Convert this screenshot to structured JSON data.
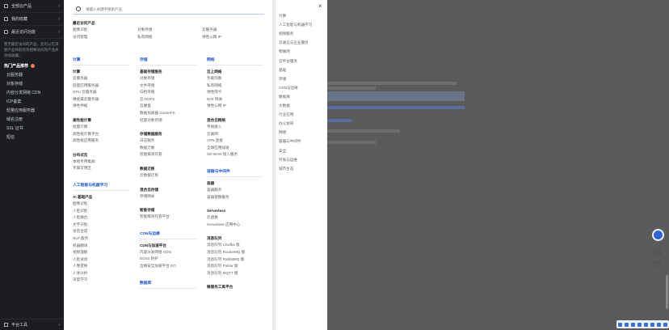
{
  "sidebar": {
    "top_rows": [
      {
        "label": "全部云产品"
      },
      {
        "label": "我的收藏"
      },
      {
        "label": "最近访问功能"
      }
    ],
    "desc": "暂无最近访问的产品。您可以在顶部产品导航找到想要访问的产品并添加收藏。",
    "hot_title": "热门产品推荐",
    "items": [
      "云服务器",
      "对象存储",
      "内容分发网络 CDN",
      "ICP备案",
      "轻量应用服务器",
      "域名注册",
      "SSL 证书",
      "短信"
    ],
    "bottom": "平台工具"
  },
  "search": {
    "placeholder": "请输入关键字搜索产品"
  },
  "columns": [
    {
      "blocks": [
        {
          "sub": "最近访问产品",
          "links": [
            "图像识别",
            "访问管理"
          ]
        }
      ]
    },
    {
      "blocks": [
        {
          "sub": "",
          "links": [
            "对象存储",
            "私有网络"
          ]
        }
      ]
    },
    {
      "blocks": [
        {
          "sub": "",
          "links": [
            "云服务器",
            "弹性公网 IP"
          ]
        }
      ]
    }
  ],
  "col1": {
    "sections": [
      {
        "cat": "计算",
        "blocks": [
          {
            "sub": "计算",
            "links": [
              "云服务器",
              "轻量应用服务器",
              "GPU 云服务器",
              "裸金属云服务器",
              "弹性伸缩"
            ]
          },
          {
            "sub": "高性能计算",
            "links": [
              "批量计算",
              "高性能计算平台",
              "高性能应用服务"
            ]
          },
          {
            "sub": "分布式云",
            "links": [
              "本地专用集群",
              "专属可用区"
            ]
          }
        ]
      },
      {
        "cat": "人工智能与机器学习",
        "blocks": [
          {
            "sub": "AI 基础产品",
            "links": [
              "图像识别",
              "人脸识别",
              "人脸融合",
              "文字识别",
              "语音合成",
              "NLP 服务",
              "机器翻译",
              "视频理解",
              "人脸试妆",
              "人像变换",
              "人体分析",
              "深度学习"
            ]
          }
        ]
      }
    ]
  },
  "col2": {
    "sections": [
      {
        "cat": "存储",
        "blocks": [
          {
            "sub": "基础存储服务",
            "links": [
              "对象存储",
              "文件存储",
              "归档存储",
              "云 HDFS",
              "云硬盘",
              "数据加速器 GooseFS",
              "轻量对象存储"
            ]
          },
          {
            "sub": "存储数据服务",
            "links": [
              "日志服务",
              "数据万象",
              "智能媒资托管"
            ]
          },
          {
            "sub": "数据迁移",
            "links": [
              "云数据迁移"
            ]
          },
          {
            "sub": "混合云存储",
            "links": [
              "存储网关"
            ]
          },
          {
            "sub": "智能存储",
            "links": [
              "智能媒资托管平台"
            ]
          }
        ]
      },
      {
        "cat": "CDN与边缘",
        "blocks": [
          {
            "sub": "CDN与加速平台",
            "links": [
              "内容分发网络 CDN",
              "DDoS 防护",
              "边缘安全加速平台 EO"
            ]
          }
        ]
      },
      {
        "cat": "数据库",
        "blocks": []
      }
    ]
  },
  "col3": {
    "sections": [
      {
        "cat": "网络",
        "blocks": [
          {
            "sub": "云上网络",
            "links": [
              "负载均衡",
              "私有网络",
              "弹性网卡",
              "NAT 网关",
              "弹性公网 IP"
            ]
          },
          {
            "sub": "混合云网络",
            "links": [
              "专线接入",
              "云联网",
              "VPN 连接",
              "全球应用加速",
              "SD-WAN 接入服务"
            ]
          }
        ]
      },
      {
        "cat": "容器与中间件",
        "blocks": [
          {
            "sub": "容器",
            "links": [
              "容器服务",
              "容器镜像服务"
            ]
          },
          {
            "sub": "Serverless",
            "links": [
              "云函数",
              "Serverless 应用中心"
            ]
          },
          {
            "sub": "消息队列",
            "links": [
              "消息队列 CKafka 版",
              "消息队列 RocketMQ 版",
              "消息队列 RabbitMQ 版",
              "消息队列 Pulsar 版",
              "消息队列 MQTT 版"
            ]
          },
          {
            "sub": "微服务工具平台",
            "links": []
          }
        ]
      }
    ]
  },
  "right_nav": [
    "计算",
    "人工智能与机器学习",
    "视频服务",
    "云通信与企业服务",
    "物联网",
    "云平台服务",
    "基础",
    "存储",
    "CDN与边缘",
    "数据库",
    "大数据",
    "行业应用",
    "办公协同",
    "网络",
    "容器与中间件",
    "安全",
    "开发与运维",
    "城市生态"
  ],
  "colors": {
    "accent": "#1a58d6",
    "sidebar_bg": "#1b1d22"
  }
}
